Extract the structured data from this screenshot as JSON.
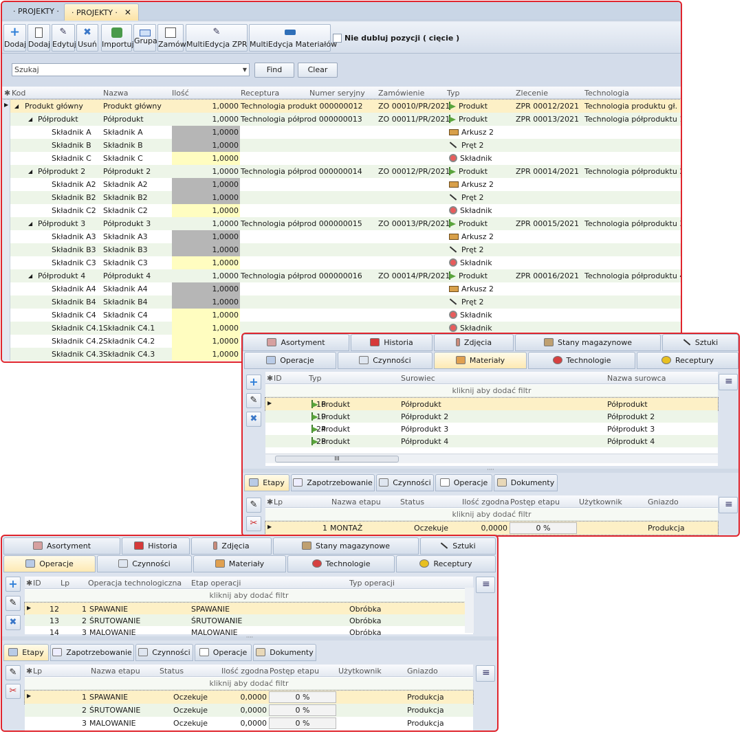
{
  "main": {
    "tabs": [
      {
        "label": "· PROJEKTY ·"
      },
      {
        "label": "· PROJEKTY ·",
        "close": "✕"
      }
    ],
    "toolbar": {
      "buttons": [
        "Dodaj",
        "Dodaj",
        "Edytuj",
        "Usuń",
        "Importuj",
        "Grupa",
        "Zamów",
        "MultiEdycja ZPR",
        "MultiEdycja Materiałów"
      ],
      "checkbox_label": "Nie dubluj pozycji ( cięcie )"
    },
    "search": {
      "value": "Szukaj",
      "find": "Find",
      "clear": "Clear"
    },
    "columns": [
      "Kod",
      "Nazwa",
      "Ilość",
      "Receptura",
      "Numer seryjny",
      "Zamówienie",
      "Typ",
      "Zlecenie",
      "Technologia"
    ],
    "rows": [
      {
        "kod": "Produkt główny",
        "nazwa": "Produkt główny",
        "ilosc": "1,0000",
        "receptura": "Technologia produkt 000000012",
        "zamowienie": "ZO 00010/PR/2021",
        "typ": "Produkt",
        "zlecenie": "ZPR 00012/2021",
        "technologia": "Technologia produktu gł."
      },
      {
        "kod": "Półprodukt",
        "nazwa": "Półprodukt",
        "ilosc": "1,0000",
        "receptura": "Technologia półprod 000000013",
        "zamowienie": "ZO 00011/PR/2021",
        "typ": "Produkt",
        "zlecenie": "ZPR 00013/2021",
        "technologia": "Technologia półproduktu 1"
      },
      {
        "kod": "Składnik A",
        "nazwa": "Składnik A",
        "ilosc": "1,0000",
        "receptura": "",
        "zamowienie": "",
        "typ": "Arkusz 2",
        "zlecenie": "",
        "technologia": ""
      },
      {
        "kod": "Składnik B",
        "nazwa": "Składnik B",
        "ilosc": "1,0000",
        "receptura": "",
        "zamowienie": "",
        "typ": "Pręt 2",
        "zlecenie": "",
        "technologia": ""
      },
      {
        "kod": "Składnik C",
        "nazwa": "Składnik C",
        "ilosc": "1,0000",
        "receptura": "",
        "zamowienie": "",
        "typ": "Składnik",
        "zlecenie": "",
        "technologia": ""
      },
      {
        "kod": "Półprodukt 2",
        "nazwa": "Półprodukt 2",
        "ilosc": "1,0000",
        "receptura": "Technologia półprod 000000014",
        "zamowienie": "ZO 00012/PR/2021",
        "typ": "Produkt",
        "zlecenie": "ZPR 00014/2021",
        "technologia": "Technologia półproduktu 2"
      },
      {
        "kod": "Składnik A2",
        "nazwa": "Składnik A2",
        "ilosc": "1,0000",
        "receptura": "",
        "zamowienie": "",
        "typ": "Arkusz 2",
        "zlecenie": "",
        "technologia": ""
      },
      {
        "kod": "Składnik B2",
        "nazwa": "Składnik B2",
        "ilosc": "1,0000",
        "receptura": "",
        "zamowienie": "",
        "typ": "Pręt 2",
        "zlecenie": "",
        "technologia": ""
      },
      {
        "kod": "Składnik C2",
        "nazwa": "Składnik C2",
        "ilosc": "1,0000",
        "receptura": "",
        "zamowienie": "",
        "typ": "Składnik",
        "zlecenie": "",
        "technologia": ""
      },
      {
        "kod": "Półprodukt 3",
        "nazwa": "Półprodukt 3",
        "ilosc": "1,0000",
        "receptura": "Technologia półprod 000000015",
        "zamowienie": "ZO 00013/PR/2021",
        "typ": "Produkt",
        "zlecenie": "ZPR 00015/2021",
        "technologia": "Technologia półproduktu 3"
      },
      {
        "kod": "Składnik A3",
        "nazwa": "Składnik A3",
        "ilosc": "1,0000",
        "receptura": "",
        "zamowienie": "",
        "typ": "Arkusz 2",
        "zlecenie": "",
        "technologia": ""
      },
      {
        "kod": "Składnik B3",
        "nazwa": "Składnik B3",
        "ilosc": "1,0000",
        "receptura": "",
        "zamowienie": "",
        "typ": "Pręt 2",
        "zlecenie": "",
        "technologia": ""
      },
      {
        "kod": "Składnik C3",
        "nazwa": "Składnik C3",
        "ilosc": "1,0000",
        "receptura": "",
        "zamowienie": "",
        "typ": "Składnik",
        "zlecenie": "",
        "technologia": ""
      },
      {
        "kod": "Półprodukt 4",
        "nazwa": "Półprodukt 4",
        "ilosc": "1,0000",
        "receptura": "Technologia półprod 000000016",
        "zamowienie": "ZO 00014/PR/2021",
        "typ": "Produkt",
        "zlecenie": "ZPR 00016/2021",
        "technologia": "Technologia półproduktu 4"
      },
      {
        "kod": "Składnik A4",
        "nazwa": "Składnik A4",
        "ilosc": "1,0000",
        "receptura": "",
        "zamowienie": "",
        "typ": "Arkusz 2",
        "zlecenie": "",
        "technologia": ""
      },
      {
        "kod": "Składnik B4",
        "nazwa": "Składnik B4",
        "ilosc": "1,0000",
        "receptura": "",
        "zamowienie": "",
        "typ": "Pręt 2",
        "zlecenie": "",
        "technologia": ""
      },
      {
        "kod": "Składnik C4",
        "nazwa": "Składnik C4",
        "ilosc": "1,0000",
        "receptura": "",
        "zamowienie": "",
        "typ": "Składnik",
        "zlecenie": "",
        "technologia": ""
      },
      {
        "kod": "Składnik C4.1",
        "nazwa": "Składnik C4.1",
        "ilosc": "1,0000",
        "receptura": "",
        "zamowienie": "",
        "typ": "Składnik",
        "zlecenie": "",
        "technologia": ""
      },
      {
        "kod": "Składnik C4.2",
        "nazwa": "Składnik C4.2",
        "ilosc": "1,0000",
        "receptura": "",
        "zamowienie": "",
        "typ": "",
        "zlecenie": "",
        "technologia": ""
      },
      {
        "kod": "Składnik C4.3",
        "nazwa": "Składnik C4.3",
        "ilosc": "1,0000",
        "receptura": "",
        "zamowienie": "",
        "typ": "",
        "zlecenie": "",
        "technologia": ""
      }
    ]
  },
  "detail_tabs_top": [
    "Asortyment",
    "Historia",
    "Zdjęcia",
    "Stany magazynowe",
    "Sztuki"
  ],
  "detail_tabs_bottom": [
    "Operacje",
    "Czynności",
    "Materiały",
    "Technologie",
    "Receptury"
  ],
  "sub_tabs": [
    "Etapy",
    "Zapotrzebowanie",
    "Czynności",
    "Operacje",
    "Dokumenty"
  ],
  "filter_text": "kliknij aby dodać filtr",
  "materials": {
    "columns": [
      "ID",
      "Typ",
      "Surowiec",
      "Nazwa surowca"
    ],
    "rows": [
      {
        "id": "16",
        "typ": "Produkt",
        "surowiec": "Półprodukt",
        "nazwa": "Półprodukt"
      },
      {
        "id": "19",
        "typ": "Produkt",
        "surowiec": "Półprodukt 2",
        "nazwa": "Półprodukt 2"
      },
      {
        "id": "24",
        "typ": "Produkt",
        "surowiec": "Półprodukt 3",
        "nazwa": "Półprodukt 3"
      },
      {
        "id": "28",
        "typ": "Produkt",
        "surowiec": "Półprodukt 4",
        "nazwa": "Półprodukt 4"
      }
    ],
    "scroll_grip": "III"
  },
  "etapy_columns": [
    "Lp",
    "Nazwa etapu",
    "Status",
    "Ilość zgodna",
    "Postęp etapu",
    "Użytkownik",
    "Gniazdo"
  ],
  "etapy_b": [
    {
      "lp": "1",
      "nazwa": "MONTAŻ",
      "status": "Oczekuje",
      "ilosc": "0,0000",
      "postep": "0 %",
      "uzytkownik": "",
      "gniazdo": "Produkcja"
    }
  ],
  "operacje": {
    "columns": [
      "ID",
      "Lp",
      "Operacja technologiczna",
      "Etap operacji",
      "Typ operacji"
    ],
    "rows": [
      {
        "id": "12",
        "lp": "1",
        "operacja": "SPAWANIE",
        "etap": "SPAWANIE",
        "typ": "Obróbka"
      },
      {
        "id": "13",
        "lp": "2",
        "operacja": "ŚRUTOWANIE",
        "etap": "ŚRUTOWANIE",
        "typ": "Obróbka"
      },
      {
        "id": "14",
        "lp": "3",
        "operacja": "MALOWANIE",
        "etap": "MALOWANIE",
        "typ": "Obróbka"
      }
    ]
  },
  "etapy_c": [
    {
      "lp": "1",
      "nazwa": "SPAWANIE",
      "status": "Oczekuje",
      "ilosc": "0,0000",
      "postep": "0 %",
      "uzytkownik": "",
      "gniazdo": "Produkcja"
    },
    {
      "lp": "2",
      "nazwa": "ŚRUTOWANIE",
      "status": "Oczekuje",
      "ilosc": "0,0000",
      "postep": "0 %",
      "uzytkownik": "",
      "gniazdo": "Produkcja"
    },
    {
      "lp": "3",
      "nazwa": "MALOWANIE",
      "status": "Oczekuje",
      "ilosc": "0,0000",
      "postep": "0 %",
      "uzytkownik": "",
      "gniazdo": "Produkcja"
    }
  ],
  "colors": {
    "accent_border": "#e0242c",
    "row_alt": "#edf5e8",
    "row_selected": "#fdf0c6",
    "qty_gray": "#b6b6b6",
    "qty_yellow": "#fffdc0"
  }
}
